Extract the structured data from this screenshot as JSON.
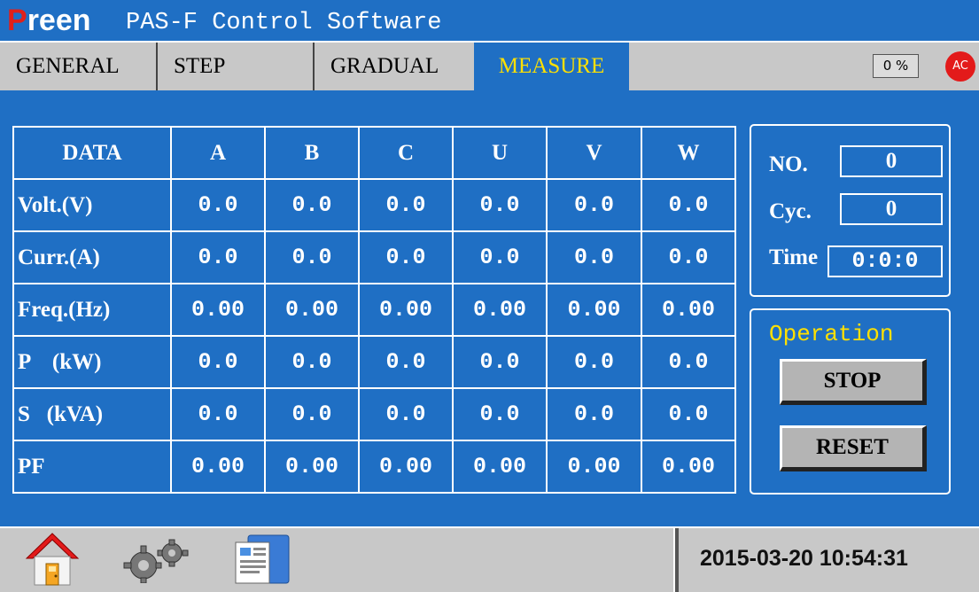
{
  "title_bar": {
    "brand_prefix": "P",
    "brand_rest": "reen",
    "app_title": "PAS-F Control Software"
  },
  "tabs": [
    {
      "label": "GENERAL",
      "active": false
    },
    {
      "label": "STEP",
      "active": false
    },
    {
      "label": "GRADUAL",
      "active": false
    },
    {
      "label": "MEASURE",
      "active": true
    }
  ],
  "indicators": {
    "percent": "0 %",
    "ac_badge": "AC"
  },
  "table": {
    "columns": [
      "DATA",
      "A",
      "B",
      "C",
      "U",
      "V",
      "W"
    ],
    "rows": [
      {
        "label": "Volt.(V)",
        "values": [
          "0.0",
          "0.0",
          "0.0",
          "0.0",
          "0.0",
          "0.0"
        ]
      },
      {
        "label": "Curr.(A)",
        "values": [
          "0.0",
          "0.0",
          "0.0",
          "0.0",
          "0.0",
          "0.0"
        ]
      },
      {
        "label": "Freq.(Hz)",
        "values": [
          "0.00",
          "0.00",
          "0.00",
          "0.00",
          "0.00",
          "0.00"
        ]
      },
      {
        "label": "P    (kW)",
        "values": [
          "0.0",
          "0.0",
          "0.0",
          "0.0",
          "0.0",
          "0.0"
        ]
      },
      {
        "label": "S   (kVA)",
        "values": [
          "0.0",
          "0.0",
          "0.0",
          "0.0",
          "0.0",
          "0.0"
        ]
      },
      {
        "label": "PF",
        "values": [
          "0.00",
          "0.00",
          "0.00",
          "0.00",
          "0.00",
          "0.00"
        ]
      }
    ]
  },
  "status": {
    "no_label": "NO.",
    "no_value": "0",
    "cyc_label": "Cyc.",
    "cyc_value": "0",
    "time_label": "Time",
    "time_value": "0:0:0"
  },
  "operation": {
    "title": "Operation",
    "stop_label": "STOP",
    "reset_label": "RESET"
  },
  "bottom_bar": {
    "icons": [
      "home-icon",
      "settings-gears-icon",
      "documents-icon"
    ],
    "datetime": "2015-03-20 10:54:31"
  },
  "colors": {
    "background": "#1f6fc4",
    "bar_gray": "#c8c8c8",
    "active_tab_text": "#ffe000",
    "brand_red": "#e0201a",
    "ac_red": "#e31a1a"
  }
}
